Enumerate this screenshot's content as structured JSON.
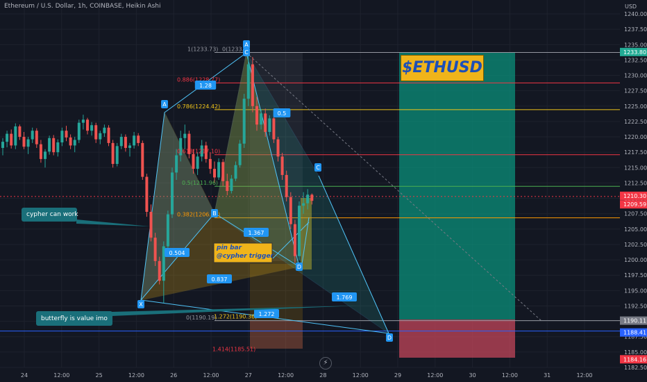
{
  "header": {
    "title": "Ethereum / U.S. Dollar, 1h, COINBASE, Heikin Ashi",
    "currency": "USD"
  },
  "brand_label": "$ETHUSD",
  "notes": {
    "cypher": "cypher can work",
    "butterfly": "butterfly is value imo",
    "pinbar_line1": "pin bar",
    "pinbar_line2": "@cypher trigger"
  },
  "chart_data": {
    "type": "candlestick",
    "symbol": "ETHUSD",
    "interval": "1h",
    "style": "Heikin Ashi",
    "ylim": [
      1182.5,
      1240.0
    ],
    "y_ticks": [
      "1240.00",
      "1237.50",
      "1235.00",
      "1232.50",
      "1230.00",
      "1227.50",
      "1225.00",
      "1222.50",
      "1220.00",
      "1217.50",
      "1215.00",
      "1212.50",
      "1210.00",
      "1207.50",
      "1205.00",
      "1202.50",
      "1200.00",
      "1197.50",
      "1195.00",
      "1192.50",
      "1190.00",
      "1187.50",
      "1185.00",
      "1182.50"
    ],
    "x_ticks": [
      "24",
      "12:00",
      "25",
      "12:00",
      "26",
      "12:00",
      "27",
      "12:00",
      "28",
      "12:00",
      "29",
      "12:00",
      "30",
      "12:00",
      "31",
      "12:00"
    ],
    "price_labels": [
      {
        "text": "1233.80",
        "color": "#22ab94"
      },
      {
        "text": "1210.30",
        "color": "#f23645"
      },
      {
        "text": "1209.59",
        "color": "#f23645"
      },
      {
        "text": "1190.11",
        "color": "#787b86"
      },
      {
        "text": "1188.41",
        "color": "#2962ff"
      },
      {
        "text": "1184.16",
        "color": "#f23645"
      }
    ],
    "fib_levels": [
      {
        "label": "1(1233.73)",
        "value": 1233.73,
        "color": "#9598a1"
      },
      {
        "label": "0.886(1228.77)",
        "value": 1228.77,
        "color": "#f23645"
      },
      {
        "label": "0.786(1224.42)",
        "value": 1224.42,
        "color": "#f0c419"
      },
      {
        "label": "0.618(1217.10)",
        "value": 1217.1,
        "color": "#f23645"
      },
      {
        "label": "0.5(1211.96)",
        "value": 1211.96,
        "color": "#4caf50"
      },
      {
        "label": "0.382(1206.83)",
        "value": 1206.83,
        "color": "#ff9800"
      },
      {
        "label": "0(1190.19)",
        "value": 1190.19,
        "color": "#9598a1"
      },
      {
        "label": "1.272(1190.36)",
        "value": 1190.36,
        "color": "#f0c419"
      },
      {
        "label": "1.414(1185.51)",
        "value": 1185.51,
        "color": "#f23645"
      }
    ],
    "fib_top_right_label": "0(1233.7",
    "pattern_points": [
      {
        "name": "X",
        "price": 1193.0
      },
      {
        "name": "A",
        "price": 1225.0
      },
      {
        "name": "B",
        "price": 1206.6
      },
      {
        "name": "A",
        "price": 1234.0
      },
      {
        "name": "C",
        "price": 1233.0
      },
      {
        "name": "D",
        "price": 1199.8
      },
      {
        "name": "C",
        "price": 1214.0
      },
      {
        "name": "D",
        "price": 1188.0
      }
    ],
    "ratios": [
      "1.28",
      "0.5",
      "0.504",
      "0.837",
      "1.367",
      "1.272",
      "1.769"
    ],
    "long_position": {
      "target": 1233.8,
      "entry": 1190.11,
      "stop": 1184.16
    },
    "candles": [
      [
        1218.2,
        1219.8,
        1217.0,
        1219.2
      ],
      [
        1219.2,
        1221.0,
        1218.3,
        1220.5
      ],
      [
        1220.5,
        1221.2,
        1218.1,
        1218.6
      ],
      [
        1218.6,
        1222.2,
        1218.0,
        1221.7
      ],
      [
        1221.7,
        1222.0,
        1219.5,
        1220.0
      ],
      [
        1220.0,
        1220.8,
        1218.0,
        1218.4
      ],
      [
        1218.4,
        1220.0,
        1217.2,
        1219.6
      ],
      [
        1219.6,
        1221.5,
        1219.0,
        1221.0
      ],
      [
        1221.0,
        1221.4,
        1218.2,
        1218.8
      ],
      [
        1218.8,
        1219.5,
        1215.8,
        1216.4
      ],
      [
        1216.4,
        1218.0,
        1215.0,
        1217.6
      ],
      [
        1217.6,
        1220.2,
        1217.1,
        1219.8
      ],
      [
        1219.8,
        1220.3,
        1217.0,
        1217.5
      ],
      [
        1217.5,
        1219.6,
        1216.8,
        1219.1
      ],
      [
        1219.1,
        1221.5,
        1218.5,
        1221.0
      ],
      [
        1221.0,
        1221.8,
        1219.3,
        1219.9
      ],
      [
        1219.9,
        1220.4,
        1218.0,
        1218.6
      ],
      [
        1218.6,
        1220.0,
        1217.5,
        1219.5
      ],
      [
        1219.5,
        1222.8,
        1219.0,
        1222.3
      ],
      [
        1222.3,
        1223.6,
        1221.2,
        1222.8
      ],
      [
        1222.8,
        1223.1,
        1220.4,
        1221.0
      ],
      [
        1221.0,
        1222.4,
        1220.2,
        1221.9
      ],
      [
        1221.9,
        1222.3,
        1219.0,
        1219.6
      ],
      [
        1219.6,
        1221.0,
        1218.8,
        1220.6
      ],
      [
        1220.6,
        1222.0,
        1220.0,
        1221.5
      ],
      [
        1221.5,
        1221.9,
        1218.5,
        1219.0
      ],
      [
        1219.0,
        1219.5,
        1215.0,
        1215.6
      ],
      [
        1215.6,
        1219.0,
        1215.2,
        1218.5
      ],
      [
        1218.5,
        1220.5,
        1218.0,
        1220.0
      ],
      [
        1220.0,
        1220.4,
        1217.6,
        1218.2
      ],
      [
        1218.2,
        1219.0,
        1216.8,
        1218.6
      ],
      [
        1218.6,
        1220.8,
        1218.1,
        1220.2
      ],
      [
        1220.2,
        1220.6,
        1218.5,
        1219.0
      ],
      [
        1219.0,
        1219.4,
        1213.0,
        1213.5
      ],
      [
        1213.5,
        1214.0,
        1207.0,
        1207.8
      ],
      [
        1207.8,
        1209.0,
        1203.0,
        1203.6
      ],
      [
        1203.6,
        1204.4,
        1199.0,
        1199.8
      ],
      [
        1199.8,
        1200.5,
        1196.0,
        1196.6
      ],
      [
        1196.6,
        1203.0,
        1193.0,
        1202.2
      ],
      [
        1202.2,
        1208.0,
        1201.5,
        1207.4
      ],
      [
        1207.4,
        1215.0,
        1206.8,
        1214.2
      ],
      [
        1214.2,
        1218.0,
        1213.0,
        1217.0
      ],
      [
        1217.0,
        1221.0,
        1216.0,
        1219.8
      ],
      [
        1219.8,
        1222.0,
        1218.0,
        1220.5
      ],
      [
        1220.5,
        1221.0,
        1216.5,
        1217.2
      ],
      [
        1217.2,
        1218.0,
        1214.0,
        1214.8
      ],
      [
        1214.8,
        1217.5,
        1213.8,
        1216.8
      ],
      [
        1216.8,
        1219.5,
        1216.0,
        1218.6
      ],
      [
        1218.6,
        1219.2,
        1215.8,
        1216.4
      ],
      [
        1216.4,
        1217.5,
        1214.0,
        1214.8
      ],
      [
        1214.8,
        1216.0,
        1212.5,
        1213.4
      ],
      [
        1213.4,
        1216.5,
        1213.0,
        1215.9
      ],
      [
        1215.9,
        1216.4,
        1212.0,
        1212.8
      ],
      [
        1212.8,
        1214.0,
        1210.5,
        1211.2
      ],
      [
        1211.2,
        1213.8,
        1210.8,
        1213.2
      ],
      [
        1213.2,
        1216.0,
        1212.8,
        1215.4
      ],
      [
        1215.4,
        1219.5,
        1215.0,
        1218.9
      ],
      [
        1218.9,
        1227.0,
        1218.2,
        1226.2
      ],
      [
        1226.2,
        1234.0,
        1225.0,
        1231.8
      ],
      [
        1231.8,
        1233.0,
        1224.0,
        1225.0
      ],
      [
        1225.0,
        1226.5,
        1221.0,
        1222.0
      ],
      [
        1222.0,
        1224.5,
        1221.2,
        1223.8
      ],
      [
        1223.8,
        1224.6,
        1220.0,
        1220.8
      ],
      [
        1220.8,
        1223.5,
        1220.2,
        1223.0
      ],
      [
        1223.0,
        1223.4,
        1219.0,
        1219.6
      ],
      [
        1219.6,
        1220.0,
        1216.0,
        1216.8
      ],
      [
        1216.8,
        1217.4,
        1213.0,
        1213.8
      ],
      [
        1213.8,
        1214.5,
        1209.5,
        1210.2
      ],
      [
        1210.2,
        1211.0,
        1205.0,
        1205.8
      ],
      [
        1205.8,
        1206.5,
        1199.5,
        1200.6
      ],
      [
        1200.6,
        1209.5,
        1200.0,
        1208.8
      ],
      [
        1208.8,
        1211.0,
        1207.5,
        1209.2
      ],
      [
        1209.2,
        1211.5,
        1208.2,
        1210.6
      ],
      [
        1210.6,
        1210.8,
        1209.0,
        1209.6
      ]
    ]
  }
}
